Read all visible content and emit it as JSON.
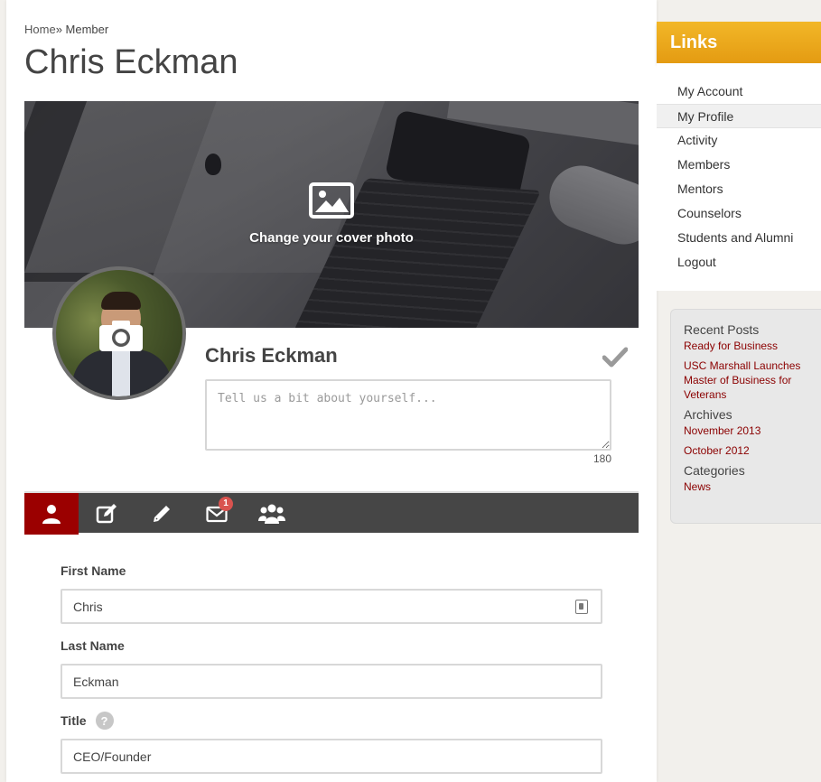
{
  "breadcrumb": {
    "home": "Home",
    "separator": "»",
    "current": "Member"
  },
  "page": {
    "title": "Chris Eckman"
  },
  "cover": {
    "change_label": "Change your cover photo"
  },
  "profile": {
    "name": "Chris Eckman",
    "bio_placeholder": "Tell us a bit about yourself...",
    "bio_counter": "180"
  },
  "tabs": [
    {
      "name": "profile",
      "icon": "user-icon",
      "active": true
    },
    {
      "name": "edit",
      "icon": "edit-icon"
    },
    {
      "name": "posts",
      "icon": "pencil-icon"
    },
    {
      "name": "messages",
      "icon": "envelope-icon",
      "badge": "1"
    },
    {
      "name": "groups",
      "icon": "group-icon"
    }
  ],
  "form": {
    "first_name": {
      "label": "First Name",
      "value": "Chris"
    },
    "last_name": {
      "label": "Last Name",
      "value": "Eckman"
    },
    "title": {
      "label": "Title",
      "help": "?",
      "value": "CEO/Founder"
    }
  },
  "sidebar": {
    "links_title": "Links",
    "links": [
      {
        "label": "My Account"
      },
      {
        "label": "My Profile",
        "active": true
      },
      {
        "label": "Activity"
      },
      {
        "label": "Members"
      },
      {
        "label": "Mentors"
      },
      {
        "label": "Counselors"
      },
      {
        "label": "Students and Alumni"
      },
      {
        "label": "Logout"
      }
    ],
    "recent_posts_title": "Recent Posts",
    "recent_posts": [
      "Ready for Business",
      "USC Marshall Launches Master of Business for Veterans"
    ],
    "archives_title": "Archives",
    "archives": [
      "November 2013",
      "October 2012"
    ],
    "categories_title": "Categories",
    "categories": [
      "News"
    ]
  },
  "colors": {
    "accent": "#9b0000",
    "links_header": "#e9a81c",
    "tabbar": "#464646",
    "widget_link": "#8b0000",
    "badge": "#d9534f"
  }
}
